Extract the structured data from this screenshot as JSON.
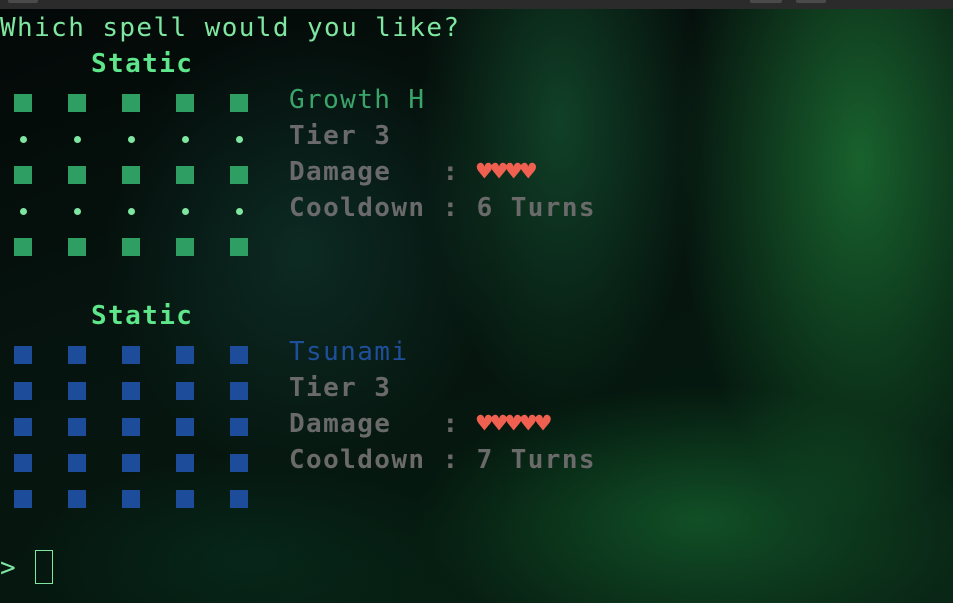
{
  "prompt": {
    "question": "Which spell would you like?",
    "input_symbol": ">"
  },
  "spells": [
    {
      "type_label": "Static",
      "name": "Growth H",
      "name_color": "#3aa56a",
      "tier": "Tier 3",
      "damage_label": "Damage   : ",
      "damage_hearts": "♥♥♥♥",
      "cooldown": "Cooldown : 6 Turns",
      "pattern_color": "#2f9e62",
      "pattern": [
        "sq",
        "sq",
        "sq",
        "sq",
        "sq",
        "dot",
        "dot",
        "dot",
        "dot",
        "dot",
        "sq",
        "sq",
        "sq",
        "sq",
        "sq",
        "dot",
        "dot",
        "dot",
        "dot",
        "dot",
        "sq",
        "sq",
        "sq",
        "sq",
        "sq"
      ]
    },
    {
      "type_label": "Static",
      "name": "Tsunami",
      "name_color": "#1f4f9a",
      "tier": "Tier 3",
      "damage_label": "Damage   : ",
      "damage_hearts": "♥♥♥♥♥",
      "cooldown": "Cooldown : 7 Turns",
      "pattern_color": "#1c4c9a",
      "pattern": [
        "sq",
        "sq",
        "sq",
        "sq",
        "sq",
        "sq",
        "sq",
        "sq",
        "sq",
        "sq",
        "sq",
        "sq",
        "sq",
        "sq",
        "sq",
        "sq",
        "sq",
        "sq",
        "sq",
        "sq",
        "sq",
        "sq",
        "sq",
        "sq",
        "sq"
      ]
    }
  ]
}
